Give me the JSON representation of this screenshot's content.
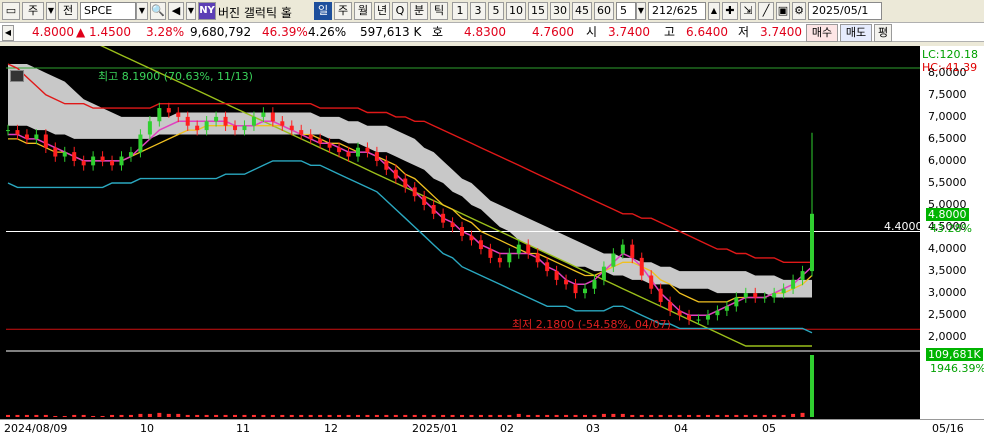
{
  "toolbar": {
    "market_tab": "주",
    "period_select": "전",
    "symbol": "SPCE",
    "ny_badge": "NY",
    "stock_name": "버진 갤럭틱 홀",
    "period_buttons": [
      "일",
      "주",
      "월",
      "년",
      "Q",
      "분",
      "틱"
    ],
    "interval_buttons": [
      "1",
      "3",
      "5",
      "10",
      "15",
      "30",
      "45",
      "60"
    ],
    "interval_value": "5",
    "page_counter": "212/625",
    "date_field": "2025/05/1"
  },
  "pricebar": {
    "price": "4.8000",
    "change": "▲ 1.4500",
    "change_pct": "3.28%",
    "volume": "9,680,792",
    "volume_pct": "46.39%",
    "turnover_pct": "4.26%",
    "amount": "597,613 K",
    "quote_label": "호",
    "ask": "4.8300",
    "bid": "4.7600",
    "open_label": "시",
    "open": "3.7400",
    "high_label": "고",
    "high": "6.6400",
    "low_label": "저",
    "low": "3.7400",
    "buy_btn": "매수",
    "sell_btn": "매도",
    "eval_btn": "평"
  },
  "chart_data": {
    "type": "candlestick",
    "ylim": [
      1.8,
      8.2
    ],
    "yticks": [
      "8,0000",
      "7,5000",
      "7,0000",
      "6,5000",
      "6,0000",
      "5,5000",
      "5,0000",
      "4,5000",
      "4,0000",
      "3,5000",
      "3,0000",
      "2,5000",
      "2,0000"
    ],
    "xlabels": [
      "2024/08/09",
      "10",
      "11",
      "12",
      "2025/01",
      "02",
      "03",
      "04",
      "05",
      "05/16"
    ],
    "annotations": {
      "high": "최고 8.1900 (70.63%, 11/13)",
      "low": "최저 2.1800 (-54.58%, 04/07)",
      "level": "4.4000"
    },
    "right_tags": {
      "lc": "LC:120.18",
      "hc": "HC:-41.39",
      "price": "4.8000",
      "price_pct": "43.28%",
      "volume": "109,681K",
      "volume_pct": "1946.39%"
    },
    "close": [
      6.7,
      6.6,
      6.5,
      6.6,
      6.3,
      6.1,
      6.2,
      6.0,
      5.9,
      6.1,
      6.0,
      5.9,
      6.1,
      6.2,
      6.6,
      6.9,
      7.2,
      7.1,
      7.0,
      6.8,
      6.7,
      6.9,
      7.0,
      6.8,
      6.7,
      6.8,
      7.0,
      7.1,
      6.9,
      6.8,
      6.7,
      6.6,
      6.5,
      6.4,
      6.3,
      6.2,
      6.1,
      6.3,
      6.2,
      6.0,
      5.8,
      5.6,
      5.4,
      5.2,
      5.0,
      4.8,
      4.6,
      4.5,
      4.3,
      4.2,
      4.0,
      3.8,
      3.7,
      3.9,
      4.1,
      3.9,
      3.7,
      3.5,
      3.3,
      3.2,
      3.0,
      3.1,
      3.3,
      3.6,
      3.9,
      4.1,
      3.8,
      3.4,
      3.1,
      2.8,
      2.6,
      2.5,
      2.4,
      2.4,
      2.5,
      2.6,
      2.7,
      2.9,
      3.0,
      2.9,
      2.9,
      3.0,
      3.1,
      3.3,
      3.5,
      4.8
    ],
    "ma_fast": [
      6.6,
      6.6,
      6.5,
      6.5,
      6.4,
      6.3,
      6.2,
      6.1,
      6.0,
      6.0,
      6.0,
      6.0,
      6.0,
      6.1,
      6.3,
      6.5,
      6.7,
      6.8,
      6.9,
      6.9,
      6.9,
      6.9,
      6.9,
      6.9,
      6.8,
      6.8,
      6.8,
      6.9,
      6.9,
      6.8,
      6.7,
      6.6,
      6.5,
      6.4,
      6.4,
      6.3,
      6.2,
      6.2,
      6.2,
      6.1,
      5.9,
      5.7,
      5.5,
      5.3,
      5.1,
      4.9,
      4.7,
      4.6,
      4.4,
      4.3,
      4.1,
      4.0,
      3.9,
      3.9,
      3.9,
      3.9,
      3.8,
      3.6,
      3.5,
      3.3,
      3.2,
      3.2,
      3.3,
      3.5,
      3.7,
      3.9,
      3.8,
      3.6,
      3.3,
      3.0,
      2.8,
      2.6,
      2.5,
      2.5,
      2.5,
      2.6,
      2.7,
      2.8,
      2.9,
      2.9,
      2.9,
      3.0,
      3.1,
      3.2,
      3.4,
      3.6
    ],
    "ma_mid": [
      6.5,
      6.5,
      6.4,
      6.4,
      6.3,
      6.2,
      6.2,
      6.1,
      6.0,
      6.0,
      6.0,
      6.0,
      6.0,
      6.1,
      6.2,
      6.3,
      6.4,
      6.5,
      6.6,
      6.7,
      6.7,
      6.8,
      6.8,
      6.8,
      6.8,
      6.8,
      6.8,
      6.8,
      6.8,
      6.8,
      6.7,
      6.6,
      6.6,
      6.5,
      6.4,
      6.4,
      6.3,
      6.2,
      6.2,
      6.1,
      6.0,
      5.9,
      5.7,
      5.6,
      5.4,
      5.2,
      5.0,
      4.9,
      4.7,
      4.6,
      4.4,
      4.3,
      4.2,
      4.1,
      4.0,
      3.9,
      3.9,
      3.8,
      3.7,
      3.6,
      3.5,
      3.4,
      3.4,
      3.5,
      3.6,
      3.7,
      3.7,
      3.6,
      3.5,
      3.3,
      3.2,
      3.0,
      2.9,
      2.8,
      2.8,
      2.8,
      2.8,
      2.9,
      2.9,
      2.9,
      2.9,
      3.0,
      3.0,
      3.1,
      3.2,
      3.4
    ],
    "ma_long": [
      5.5,
      5.4,
      5.4,
      5.4,
      5.4,
      5.4,
      5.4,
      5.4,
      5.4,
      5.4,
      5.4,
      5.5,
      5.5,
      5.5,
      5.6,
      5.6,
      5.6,
      5.6,
      5.6,
      5.6,
      5.6,
      5.6,
      5.6,
      5.7,
      5.7,
      5.7,
      5.8,
      5.9,
      6.0,
      6.0,
      6.0,
      6.0,
      5.9,
      5.9,
      5.8,
      5.7,
      5.6,
      5.5,
      5.4,
      5.3,
      5.1,
      4.9,
      4.7,
      4.5,
      4.3,
      4.1,
      3.9,
      3.8,
      3.6,
      3.5,
      3.4,
      3.3,
      3.2,
      3.1,
      3.0,
      2.9,
      2.8,
      2.7,
      2.7,
      2.7,
      2.6,
      2.6,
      2.6,
      2.6,
      2.7,
      2.7,
      2.6,
      2.5,
      2.4,
      2.3,
      2.3,
      2.2,
      2.2,
      2.2,
      2.2,
      2.2,
      2.2,
      2.2,
      2.2,
      2.2,
      2.2,
      2.2,
      2.2,
      2.2,
      2.2,
      2.1
    ],
    "ma_red": [
      8.2,
      8.1,
      7.9,
      7.7,
      7.5,
      7.4,
      7.3,
      7.3,
      7.3,
      7.2,
      7.2,
      7.2,
      7.2,
      7.2,
      7.2,
      7.2,
      7.3,
      7.3,
      7.3,
      7.3,
      7.3,
      7.3,
      7.3,
      7.3,
      7.3,
      7.3,
      7.3,
      7.3,
      7.3,
      7.3,
      7.3,
      7.3,
      7.3,
      7.2,
      7.2,
      7.2,
      7.2,
      7.2,
      7.1,
      7.1,
      7.1,
      7.0,
      7.0,
      6.9,
      6.9,
      6.8,
      6.7,
      6.6,
      6.5,
      6.4,
      6.3,
      6.2,
      6.1,
      6.0,
      5.9,
      5.8,
      5.7,
      5.6,
      5.5,
      5.4,
      5.3,
      5.2,
      5.1,
      5.0,
      4.9,
      4.8,
      4.8,
      4.7,
      4.7,
      4.6,
      4.5,
      4.4,
      4.3,
      4.2,
      4.1,
      4.0,
      4.0,
      3.9,
      3.9,
      3.8,
      3.8,
      3.8,
      3.7,
      3.7,
      3.7,
      3.7
    ],
    "ma_green": [
      9.6,
      9.5,
      9.4,
      9.3,
      9.2,
      9.1,
      9.0,
      8.9,
      8.8,
      8.7,
      8.6,
      8.5,
      8.4,
      8.3,
      8.2,
      8.1,
      8.0,
      7.9,
      7.8,
      7.7,
      7.6,
      7.5,
      7.4,
      7.3,
      7.2,
      7.1,
      7.0,
      6.9,
      6.8,
      6.7,
      6.6,
      6.5,
      6.4,
      6.3,
      6.2,
      6.1,
      6.0,
      5.9,
      5.8,
      5.7,
      5.6,
      5.5,
      5.4,
      5.3,
      5.2,
      5.1,
      5.0,
      4.9,
      4.8,
      4.7,
      4.6,
      4.5,
      4.4,
      4.3,
      4.2,
      4.1,
      4.0,
      3.9,
      3.8,
      3.7,
      3.6,
      3.5,
      3.4,
      3.3,
      3.2,
      3.1,
      3.0,
      2.9,
      2.8,
      2.7,
      2.6,
      2.5,
      2.4,
      2.3,
      2.2,
      2.1,
      2.0,
      1.9,
      1.8,
      1.8,
      1.8,
      1.8,
      1.8,
      1.8,
      1.8,
      1.8
    ],
    "cloud_top": [
      8.2,
      8.2,
      8.2,
      8.1,
      8.0,
      7.9,
      7.8,
      7.6,
      7.4,
      7.3,
      7.2,
      7.1,
      7.0,
      7.0,
      7.0,
      7.0,
      7.0,
      7.0,
      7.1,
      7.1,
      7.1,
      7.1,
      7.1,
      7.1,
      7.1,
      7.1,
      7.1,
      7.1,
      7.1,
      7.1,
      7.1,
      7.1,
      7.1,
      7.0,
      7.0,
      7.0,
      6.9,
      6.9,
      6.8,
      6.8,
      6.8,
      6.7,
      6.6,
      6.5,
      6.3,
      6.2,
      6.0,
      5.8,
      5.6,
      5.5,
      5.3,
      5.1,
      5.0,
      4.9,
      4.8,
      4.7,
      4.6,
      4.5,
      4.4,
      4.3,
      4.2,
      4.1,
      4.0,
      3.9,
      3.9,
      3.8,
      3.8,
      3.7,
      3.7,
      3.6,
      3.6,
      3.5,
      3.5,
      3.5,
      3.5,
      3.5,
      3.5,
      3.5,
      3.5,
      3.4,
      3.4,
      3.4,
      3.3,
      3.3,
      3.3,
      3.3
    ],
    "cloud_bottom": [
      6.8,
      6.8,
      6.8,
      6.7,
      6.7,
      6.6,
      6.6,
      6.5,
      6.5,
      6.5,
      6.5,
      6.5,
      6.5,
      6.5,
      6.5,
      6.5,
      6.6,
      6.6,
      6.6,
      6.6,
      6.6,
      6.6,
      6.6,
      6.6,
      6.6,
      6.6,
      6.6,
      6.6,
      6.6,
      6.6,
      6.6,
      6.6,
      6.6,
      6.6,
      6.5,
      6.5,
      6.4,
      6.4,
      6.3,
      6.2,
      6.2,
      6.1,
      6.0,
      5.9,
      5.8,
      5.6,
      5.5,
      5.3,
      5.2,
      5.0,
      4.9,
      4.7,
      4.5,
      4.4,
      4.2,
      4.1,
      4.0,
      3.9,
      3.8,
      3.7,
      3.6,
      3.6,
      3.5,
      3.5,
      3.4,
      3.4,
      3.3,
      3.3,
      3.2,
      3.2,
      3.2,
      3.1,
      3.1,
      3.1,
      3.1,
      3.0,
      3.0,
      3.0,
      3.0,
      3.0,
      3.0,
      2.9,
      2.9,
      2.9,
      2.9,
      2.9
    ],
    "volumes": [
      2,
      2,
      2,
      2,
      2,
      1,
      1,
      2,
      2,
      1,
      1,
      2,
      2,
      2,
      3,
      3,
      4,
      3,
      3,
      2,
      2,
      2,
      2,
      2,
      2,
      2,
      2,
      2,
      2,
      2,
      2,
      2,
      2,
      2,
      2,
      2,
      2,
      2,
      2,
      2,
      2,
      2,
      2,
      2,
      2,
      2,
      2,
      2,
      2,
      2,
      2,
      2,
      2,
      2,
      3,
      2,
      2,
      2,
      2,
      2,
      2,
      2,
      2,
      3,
      3,
      3,
      2,
      2,
      2,
      2,
      2,
      2,
      2,
      2,
      2,
      2,
      2,
      2,
      2,
      2,
      2,
      2,
      2,
      3,
      4,
      60
    ]
  }
}
